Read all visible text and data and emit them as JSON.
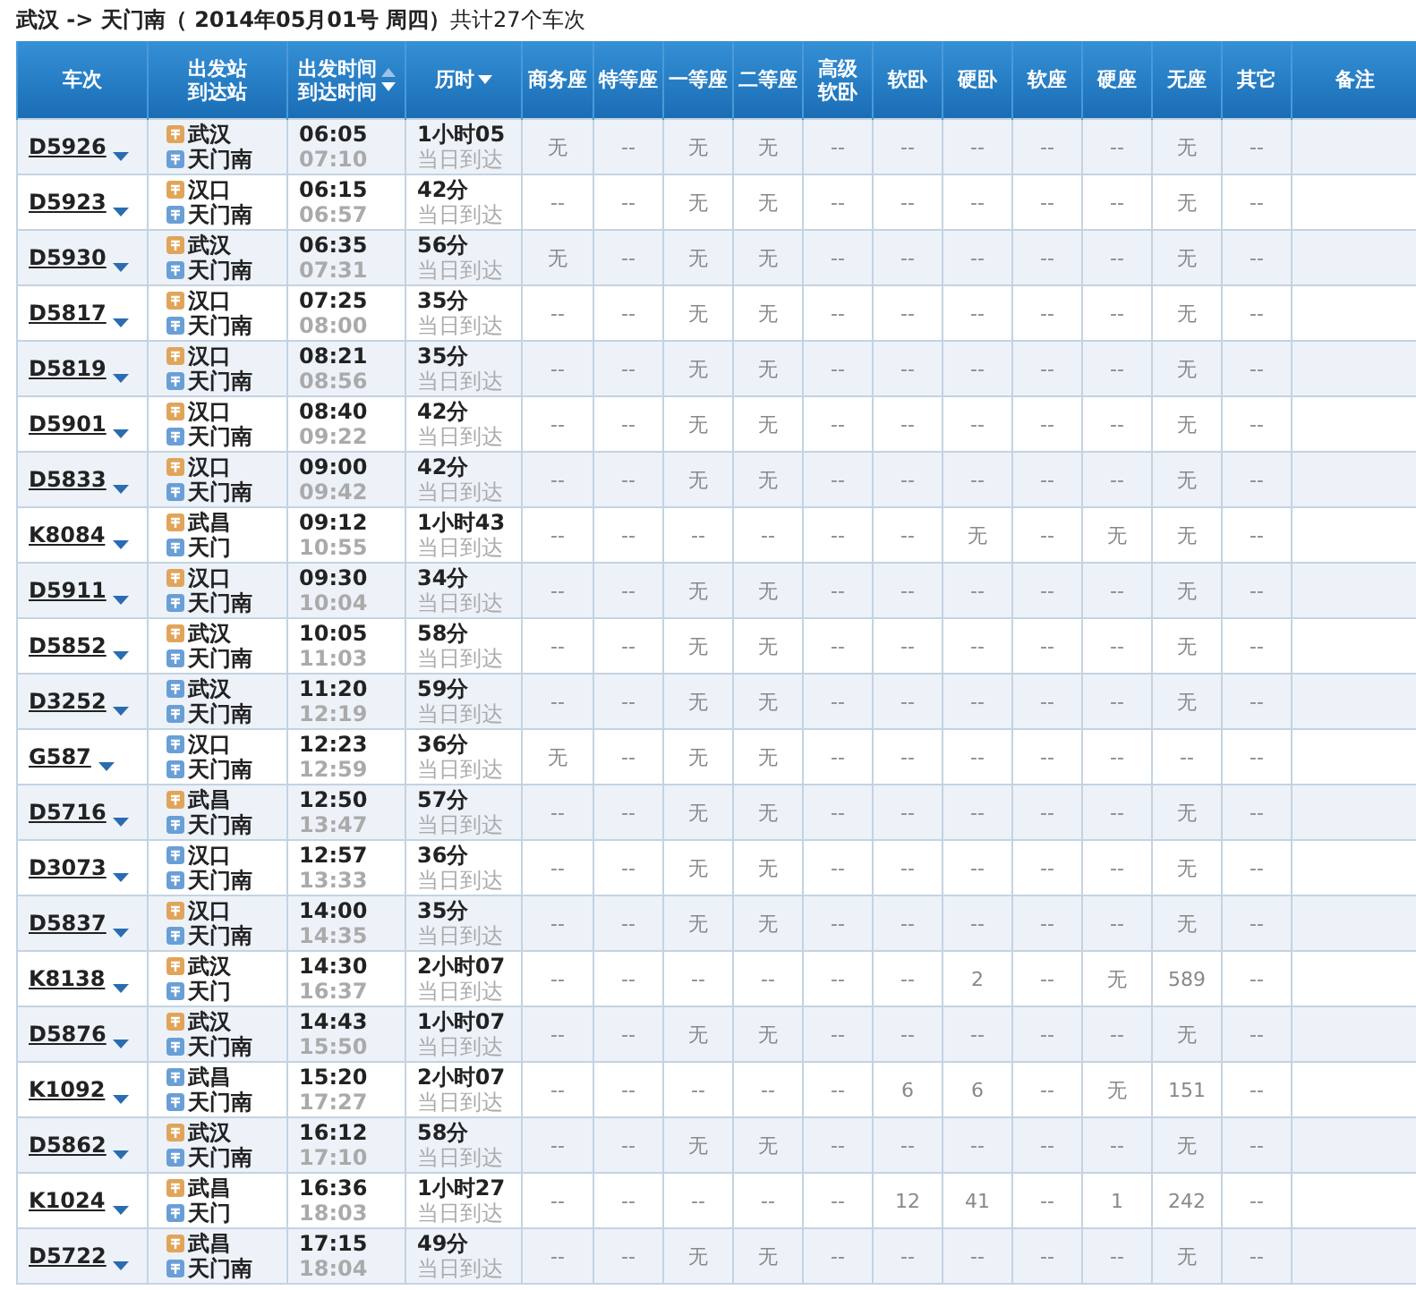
{
  "title": "武汉 -> 天门南（ 2014年05月01号  周四）",
  "count": "共计27个车次",
  "columns": [
    {
      "lines": [
        "车次"
      ],
      "up_arrow": false,
      "down_arrow": false
    },
    {
      "lines": [
        "出发站",
        "到达站"
      ],
      "up_arrow": false,
      "down_arrow": false
    },
    {
      "lines": [
        "出发时间",
        "到达时间"
      ],
      "up_arrow": true,
      "down_arrow": true
    },
    {
      "lines": [
        "历时"
      ],
      "up_arrow": false,
      "down_arrow": true
    },
    {
      "lines": [
        "商务座"
      ],
      "up_arrow": false,
      "down_arrow": false
    },
    {
      "lines": [
        "特等座"
      ],
      "up_arrow": false,
      "down_arrow": false
    },
    {
      "lines": [
        "一等座"
      ],
      "up_arrow": false,
      "down_arrow": false
    },
    {
      "lines": [
        "二等座"
      ],
      "up_arrow": false,
      "down_arrow": false
    },
    {
      "lines": [
        "高级",
        "软卧"
      ],
      "up_arrow": false,
      "down_arrow": false
    },
    {
      "lines": [
        "软卧"
      ],
      "up_arrow": false,
      "down_arrow": false
    },
    {
      "lines": [
        "硬卧"
      ],
      "up_arrow": false,
      "down_arrow": false
    },
    {
      "lines": [
        "软座"
      ],
      "up_arrow": false,
      "down_arrow": false
    },
    {
      "lines": [
        "硬座"
      ],
      "up_arrow": false,
      "down_arrow": false
    },
    {
      "lines": [
        "无座"
      ],
      "up_arrow": false,
      "down_arrow": false
    },
    {
      "lines": [
        "其它"
      ],
      "up_arrow": false,
      "down_arrow": false
    },
    {
      "lines": [
        "备注"
      ],
      "up_arrow": false,
      "down_arrow": false
    }
  ],
  "rows": [
    {
      "train": "D5926",
      "from": "武汉",
      "origin": true,
      "to": "天门南",
      "dep": "06:05",
      "arr": "07:10",
      "duration": "1小时05",
      "arrival_day": "当日到达",
      "seats": [
        "无",
        "--",
        "无",
        "无",
        "--",
        "--",
        "--",
        "--",
        "--",
        "无",
        "--"
      ]
    },
    {
      "train": "D5923",
      "from": "汉口",
      "origin": true,
      "to": "天门南",
      "dep": "06:15",
      "arr": "06:57",
      "duration": "42分",
      "arrival_day": "当日到达",
      "seats": [
        "--",
        "--",
        "无",
        "无",
        "--",
        "--",
        "--",
        "--",
        "--",
        "无",
        "--"
      ]
    },
    {
      "train": "D5930",
      "from": "武汉",
      "origin": true,
      "to": "天门南",
      "dep": "06:35",
      "arr": "07:31",
      "duration": "56分",
      "arrival_day": "当日到达",
      "seats": [
        "无",
        "--",
        "无",
        "无",
        "--",
        "--",
        "--",
        "--",
        "--",
        "无",
        "--"
      ]
    },
    {
      "train": "D5817",
      "from": "汉口",
      "origin": true,
      "to": "天门南",
      "dep": "07:25",
      "arr": "08:00",
      "duration": "35分",
      "arrival_day": "当日到达",
      "seats": [
        "--",
        "--",
        "无",
        "无",
        "--",
        "--",
        "--",
        "--",
        "--",
        "无",
        "--"
      ]
    },
    {
      "train": "D5819",
      "from": "汉口",
      "origin": true,
      "to": "天门南",
      "dep": "08:21",
      "arr": "08:56",
      "duration": "35分",
      "arrival_day": "当日到达",
      "seats": [
        "--",
        "--",
        "无",
        "无",
        "--",
        "--",
        "--",
        "--",
        "--",
        "无",
        "--"
      ]
    },
    {
      "train": "D5901",
      "from": "汉口",
      "origin": true,
      "to": "天门南",
      "dep": "08:40",
      "arr": "09:22",
      "duration": "42分",
      "arrival_day": "当日到达",
      "seats": [
        "--",
        "--",
        "无",
        "无",
        "--",
        "--",
        "--",
        "--",
        "--",
        "无",
        "--"
      ]
    },
    {
      "train": "D5833",
      "from": "汉口",
      "origin": true,
      "to": "天门南",
      "dep": "09:00",
      "arr": "09:42",
      "duration": "42分",
      "arrival_day": "当日到达",
      "seats": [
        "--",
        "--",
        "无",
        "无",
        "--",
        "--",
        "--",
        "--",
        "--",
        "无",
        "--"
      ]
    },
    {
      "train": "K8084",
      "from": "武昌",
      "origin": true,
      "to": "天门",
      "dep": "09:12",
      "arr": "10:55",
      "duration": "1小时43",
      "arrival_day": "当日到达",
      "seats": [
        "--",
        "--",
        "--",
        "--",
        "--",
        "--",
        "无",
        "--",
        "无",
        "无",
        "--"
      ]
    },
    {
      "train": "D5911",
      "from": "汉口",
      "origin": true,
      "to": "天门南",
      "dep": "09:30",
      "arr": "10:04",
      "duration": "34分",
      "arrival_day": "当日到达",
      "seats": [
        "--",
        "--",
        "无",
        "无",
        "--",
        "--",
        "--",
        "--",
        "--",
        "无",
        "--"
      ]
    },
    {
      "train": "D5852",
      "from": "武汉",
      "origin": true,
      "to": "天门南",
      "dep": "10:05",
      "arr": "11:03",
      "duration": "58分",
      "arrival_day": "当日到达",
      "seats": [
        "--",
        "--",
        "无",
        "无",
        "--",
        "--",
        "--",
        "--",
        "--",
        "无",
        "--"
      ]
    },
    {
      "train": "D3252",
      "from": "武汉",
      "origin": false,
      "to": "天门南",
      "dep": "11:20",
      "arr": "12:19",
      "duration": "59分",
      "arrival_day": "当日到达",
      "seats": [
        "--",
        "--",
        "无",
        "无",
        "--",
        "--",
        "--",
        "--",
        "--",
        "无",
        "--"
      ]
    },
    {
      "train": "G587",
      "from": "汉口",
      "origin": false,
      "to": "天门南",
      "dep": "12:23",
      "arr": "12:59",
      "duration": "36分",
      "arrival_day": "当日到达",
      "seats": [
        "无",
        "--",
        "无",
        "无",
        "--",
        "--",
        "--",
        "--",
        "--",
        "--",
        "--"
      ]
    },
    {
      "train": "D5716",
      "from": "武昌",
      "origin": true,
      "to": "天门南",
      "dep": "12:50",
      "arr": "13:47",
      "duration": "57分",
      "arrival_day": "当日到达",
      "seats": [
        "--",
        "--",
        "无",
        "无",
        "--",
        "--",
        "--",
        "--",
        "--",
        "无",
        "--"
      ]
    },
    {
      "train": "D3073",
      "from": "汉口",
      "origin": false,
      "to": "天门南",
      "dep": "12:57",
      "arr": "13:33",
      "duration": "36分",
      "arrival_day": "当日到达",
      "seats": [
        "--",
        "--",
        "无",
        "无",
        "--",
        "--",
        "--",
        "--",
        "--",
        "无",
        "--"
      ]
    },
    {
      "train": "D5837",
      "from": "汉口",
      "origin": true,
      "to": "天门南",
      "dep": "14:00",
      "arr": "14:35",
      "duration": "35分",
      "arrival_day": "当日到达",
      "seats": [
        "--",
        "--",
        "无",
        "无",
        "--",
        "--",
        "--",
        "--",
        "--",
        "无",
        "--"
      ]
    },
    {
      "train": "K8138",
      "from": "武汉",
      "origin": true,
      "to": "天门",
      "dep": "14:30",
      "arr": "16:37",
      "duration": "2小时07",
      "arrival_day": "当日到达",
      "seats": [
        "--",
        "--",
        "--",
        "--",
        "--",
        "--",
        "2",
        "--",
        "无",
        "589",
        "--"
      ]
    },
    {
      "train": "D5876",
      "from": "武汉",
      "origin": true,
      "to": "天门南",
      "dep": "14:43",
      "arr": "15:50",
      "duration": "1小时07",
      "arrival_day": "当日到达",
      "seats": [
        "--",
        "--",
        "无",
        "无",
        "--",
        "--",
        "--",
        "--",
        "--",
        "无",
        "--"
      ]
    },
    {
      "train": "K1092",
      "from": "武昌",
      "origin": false,
      "to": "天门南",
      "dep": "15:20",
      "arr": "17:27",
      "duration": "2小时07",
      "arrival_day": "当日到达",
      "seats": [
        "--",
        "--",
        "--",
        "--",
        "--",
        "6",
        "6",
        "--",
        "无",
        "151",
        "--"
      ]
    },
    {
      "train": "D5862",
      "from": "武汉",
      "origin": true,
      "to": "天门南",
      "dep": "16:12",
      "arr": "17:10",
      "duration": "58分",
      "arrival_day": "当日到达",
      "seats": [
        "--",
        "--",
        "无",
        "无",
        "--",
        "--",
        "--",
        "--",
        "--",
        "无",
        "--"
      ]
    },
    {
      "train": "K1024",
      "from": "武昌",
      "origin": true,
      "to": "天门",
      "dep": "16:36",
      "arr": "18:03",
      "duration": "1小时27",
      "arrival_day": "当日到达",
      "seats": [
        "--",
        "--",
        "--",
        "--",
        "--",
        "12",
        "41",
        "--",
        "1",
        "242",
        "--"
      ]
    },
    {
      "train": "D5722",
      "from": "武昌",
      "origin": true,
      "to": "天门南",
      "dep": "17:15",
      "arr": "18:04",
      "duration": "49分",
      "arrival_day": "当日到达",
      "seats": [
        "--",
        "--",
        "无",
        "无",
        "--",
        "--",
        "--",
        "--",
        "--",
        "无",
        "--"
      ]
    }
  ]
}
